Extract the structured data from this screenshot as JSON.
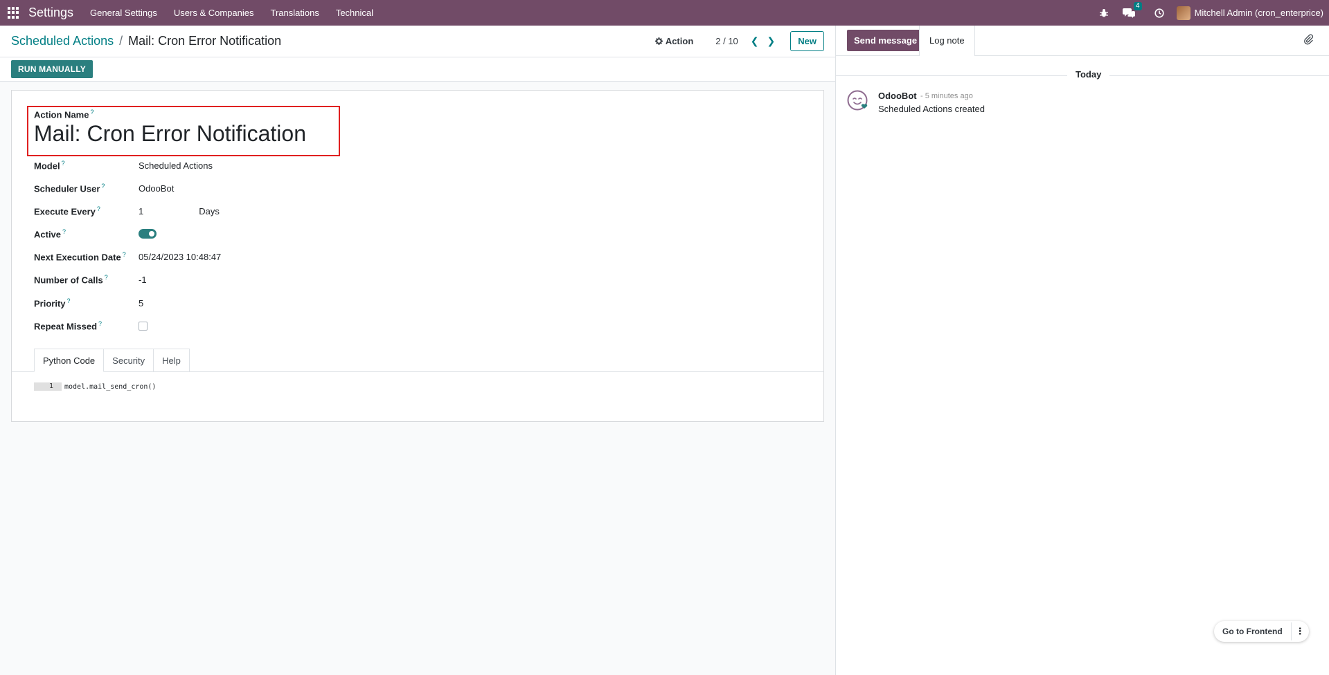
{
  "navbar": {
    "brand": "Settings",
    "menu": [
      "General Settings",
      "Users & Companies",
      "Translations",
      "Technical"
    ],
    "messages_badge": "4",
    "user": "Mitchell Admin (cron_enterprice)"
  },
  "control": {
    "breadcrumb_parent": "Scheduled Actions",
    "breadcrumb_sep": "/",
    "breadcrumb_current": "Mail: Cron Error Notification",
    "action_label": "Action",
    "pager": "2 / 10",
    "new_label": "New"
  },
  "statusbar": {
    "run_label": "RUN MANUALLY"
  },
  "form": {
    "title_label": "Action Name",
    "title_value": "Mail: Cron Error Notification",
    "help_mark": "?",
    "fields": {
      "model": {
        "label": "Model",
        "value": "Scheduled Actions"
      },
      "user": {
        "label": "Scheduler User",
        "value": "OdooBot"
      },
      "execute": {
        "label": "Execute Every",
        "value": "1",
        "unit": "Days"
      },
      "active": {
        "label": "Active",
        "value": true
      },
      "next_date": {
        "label": "Next Execution Date",
        "value": "05/24/2023 10:48:47"
      },
      "calls": {
        "label": "Number of Calls",
        "value": "-1"
      },
      "priority": {
        "label": "Priority",
        "value": "5"
      },
      "repeat": {
        "label": "Repeat Missed",
        "value": false
      }
    },
    "tabs": [
      "Python Code",
      "Security",
      "Help"
    ],
    "code": {
      "line_no": "1",
      "text": "model.mail_send_cron()"
    }
  },
  "chatter": {
    "send_label": "Send message",
    "log_label": "Log note",
    "date_sep": "Today",
    "message": {
      "author": "OdooBot",
      "time": "- 5 minutes ago",
      "body": "Scheduled Actions created"
    }
  },
  "frontend": {
    "label": "Go to Frontend"
  },
  "colors": {
    "brand": "#714b67",
    "accent": "#017e84",
    "highlight": "#e02020"
  }
}
